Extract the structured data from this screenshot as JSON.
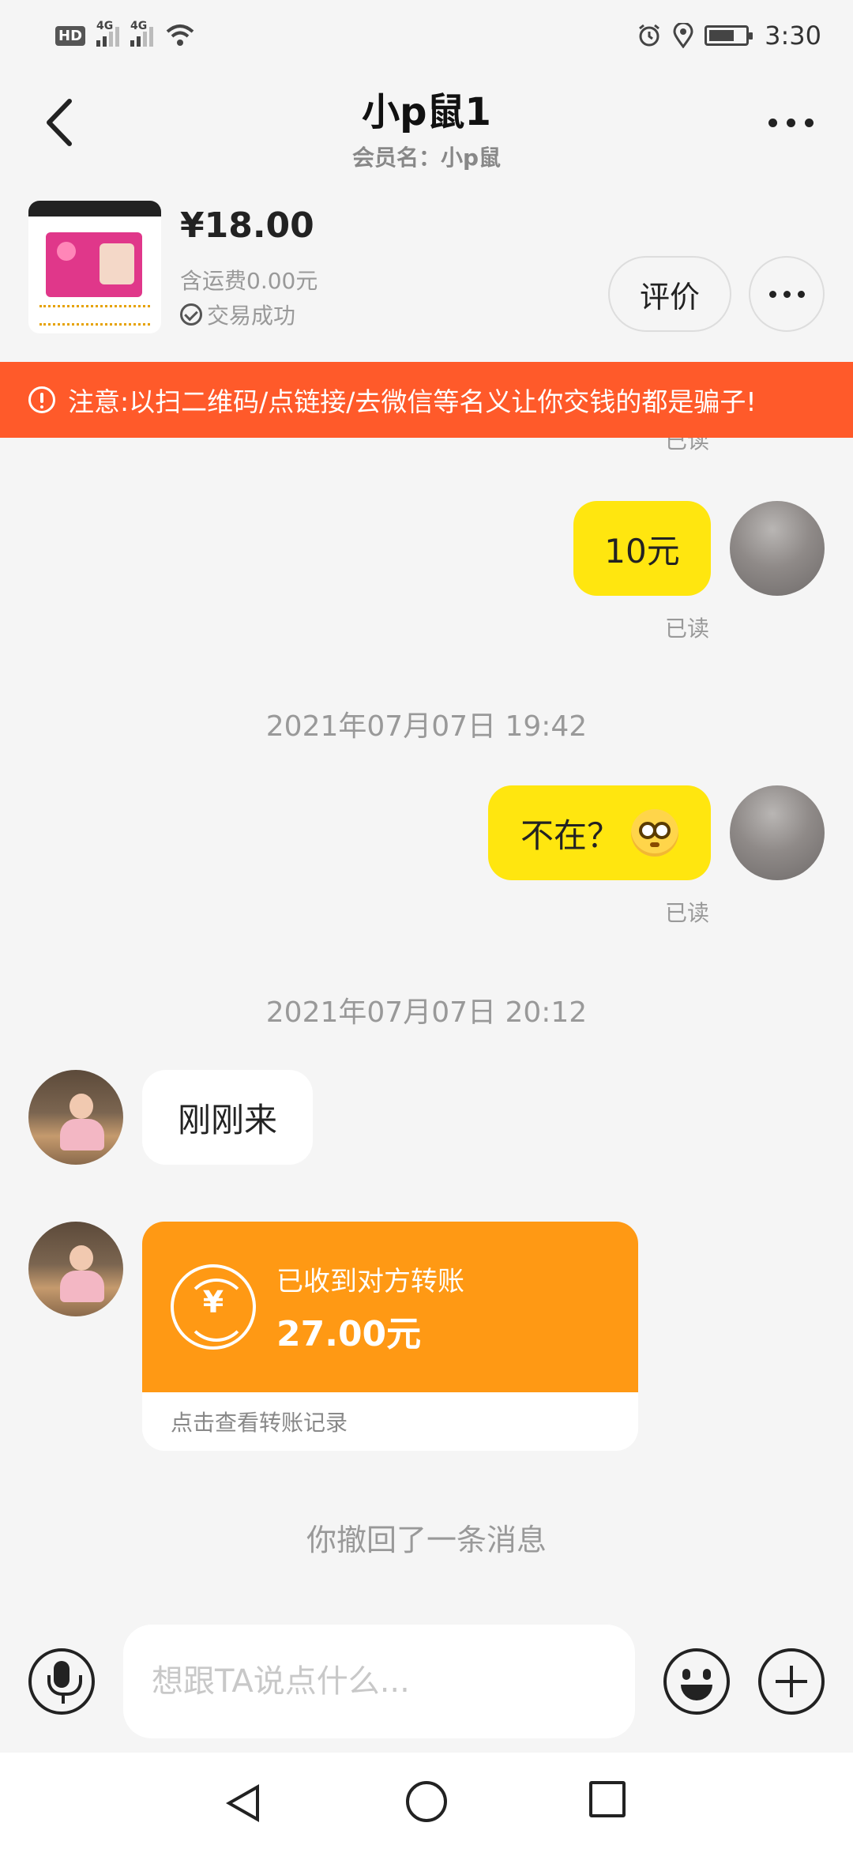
{
  "status_bar": {
    "hd": "HD",
    "network1": "4G",
    "network2": "4G",
    "time": "3:30",
    "icons": [
      "wifi-icon",
      "alarm-icon",
      "location-icon",
      "battery-icon"
    ]
  },
  "header": {
    "title": "小p鼠1",
    "member_name": "会员名：小p鼠"
  },
  "product": {
    "price": "¥18.00",
    "shipping": "含运费0.00元",
    "status": "交易成功",
    "review_label": "评价"
  },
  "warning": {
    "text": "注意:以扫二维码/点链接/去微信等名义让你交钱的都是骗子!",
    "color": "#ff5a2a"
  },
  "messages": {
    "read_label": "已读",
    "msg1": "10元",
    "timestamp1": "2021年07月07日 19:42",
    "msg2": "不在？",
    "timestamp2": "2021年07月07日 20:12",
    "msg3": "刚刚来",
    "transfer": {
      "label": "已收到对方转账",
      "amount": "27.00元",
      "yen": "¥",
      "link": "点击查看转账记录"
    },
    "recall": "你撤回了一条消息"
  },
  "input": {
    "placeholder": "想跟TA说点什么..."
  },
  "colors": {
    "my_bubble": "#ffe60f",
    "transfer": "#ff9914",
    "background": "#f5f5f5"
  }
}
